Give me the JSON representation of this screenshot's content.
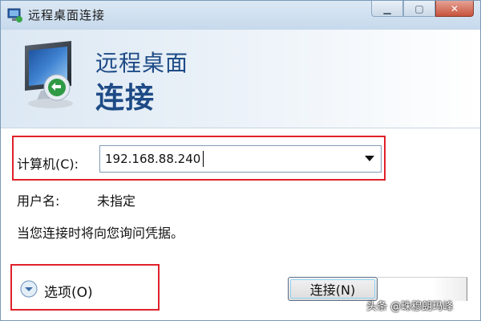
{
  "window": {
    "title": "远程桌面连接"
  },
  "header": {
    "line1": "远程桌面",
    "line2": "连接"
  },
  "computer": {
    "label": "计算机(C):",
    "value": "192.168.88.240"
  },
  "username": {
    "label": "用户名:",
    "value": "未指定"
  },
  "hint": "当您连接时将向您询问凭据。",
  "options": {
    "label": "选项(O)"
  },
  "buttons": {
    "connect": "连接(N)"
  },
  "watermark": "头条 @珠穆朗玛峰",
  "icons": {
    "app": "remote-desktop-icon",
    "header": "monitor-icon",
    "options": "expand-options-icon",
    "combo": "dropdown-arrow-icon"
  },
  "colors": {
    "header_text": "#1e4b86",
    "highlight_box": "#e0212b"
  }
}
